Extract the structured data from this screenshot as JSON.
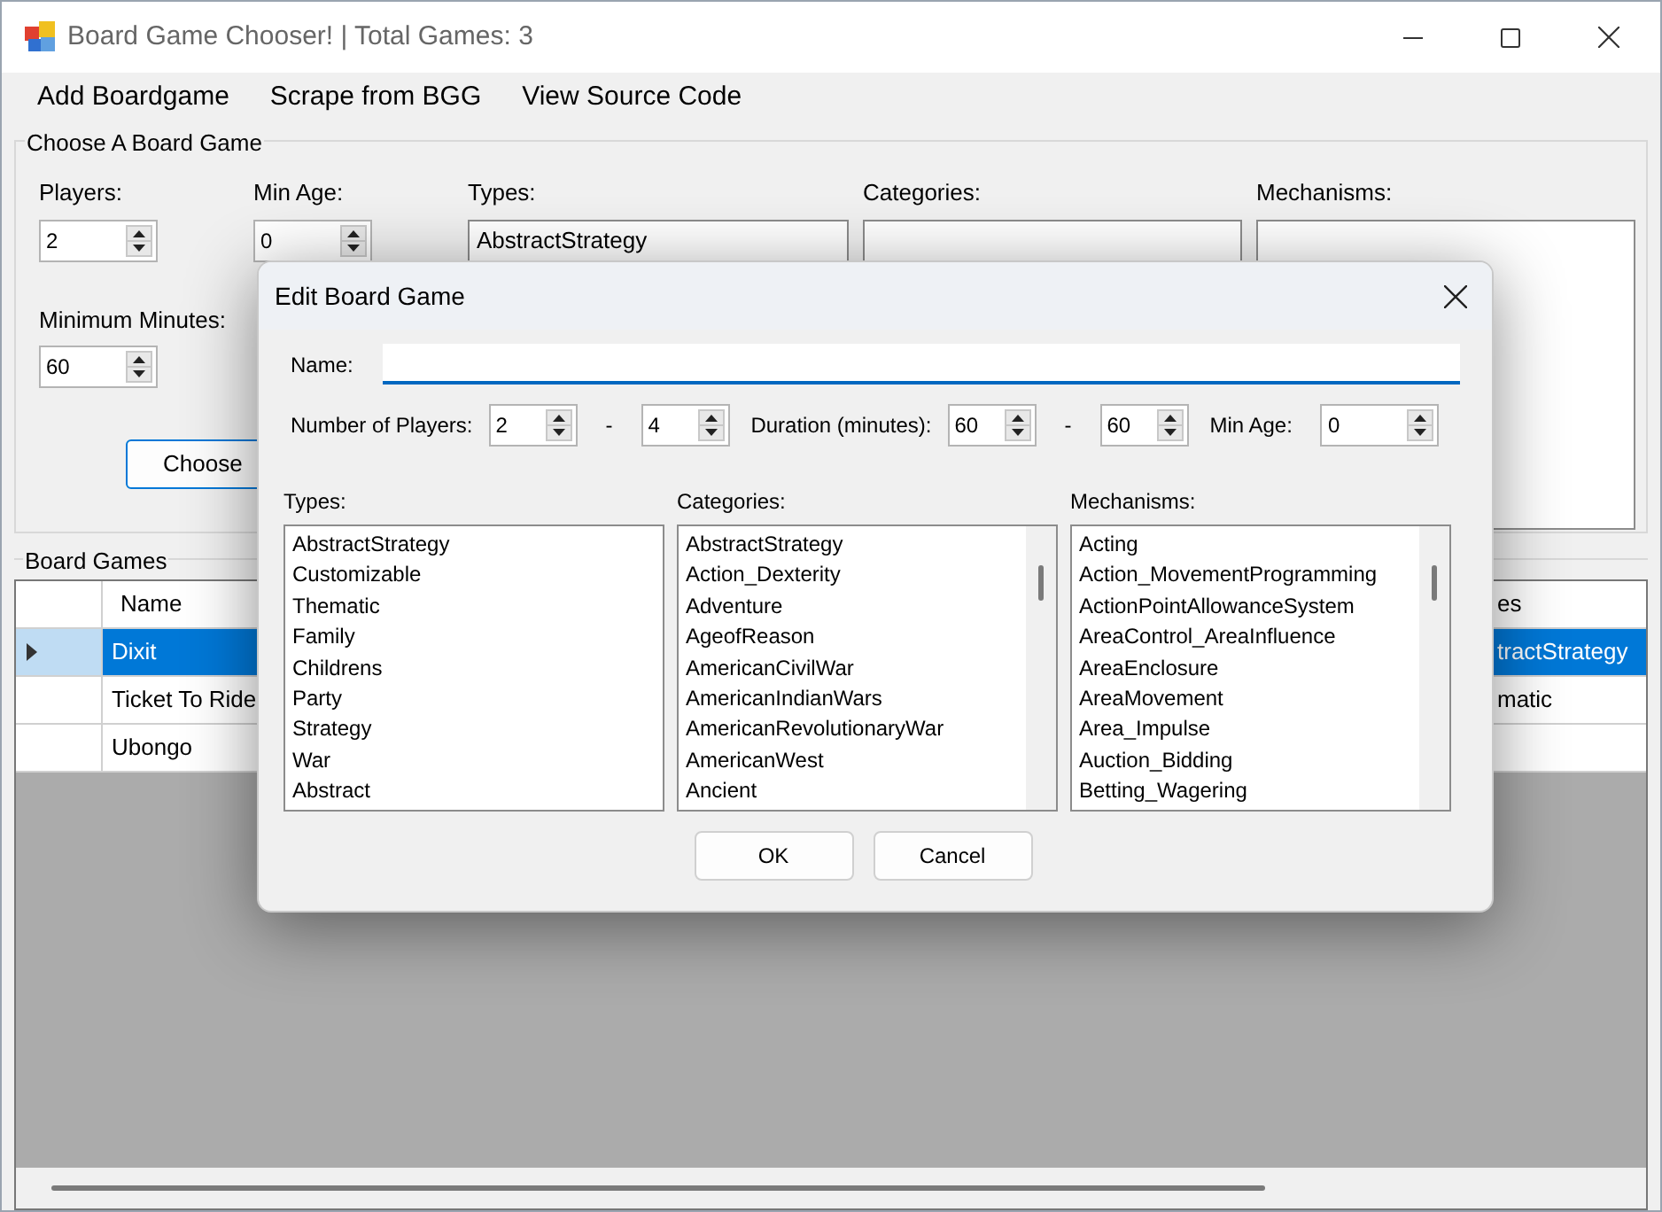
{
  "window": {
    "title": "Board Game Chooser! | Total Games: 3"
  },
  "menu": [
    "Add Boardgame",
    "Scrape from BGG",
    "View Source Code"
  ],
  "filter_group": {
    "title": "Choose A Board Game",
    "players": {
      "label": "Players:",
      "value": "2"
    },
    "min_age": {
      "label": "Min Age:",
      "value": "0"
    },
    "minimum_minutes": {
      "label": "Minimum Minutes:",
      "value": "60"
    },
    "types": {
      "label": "Types:",
      "items": [
        "AbstractStrategy"
      ]
    },
    "categories": {
      "label": "Categories:"
    },
    "mechanisms": {
      "label": "Mechanisms:"
    },
    "choose_button": "Choose"
  },
  "games_group": {
    "title": "Board Games",
    "columns": [
      "Name",
      "es"
    ],
    "rows": [
      {
        "cells": [
          "Dixit",
          "tractStrategy"
        ],
        "selected": true
      },
      {
        "cells": [
          "Ticket To Ride",
          "matic"
        ],
        "selected": false
      },
      {
        "cells": [
          "Ubongo",
          ""
        ],
        "selected": false
      }
    ]
  },
  "dialog": {
    "title": "Edit Board Game",
    "name_label": "Name:",
    "players_label": "Number of Players:",
    "players_min": "2",
    "players_max": "4",
    "duration_label": "Duration (minutes):",
    "duration_min": "60",
    "duration_max": "60",
    "min_age_label": "Min Age:",
    "min_age": "0",
    "range_separator": "-",
    "lists": [
      {
        "label": "Types:",
        "scrollbar": false,
        "items": [
          "AbstractStrategy",
          "Customizable",
          "Thematic",
          "Family",
          "Childrens",
          "Party",
          "Strategy",
          "War",
          "Abstract"
        ]
      },
      {
        "label": "Categories:",
        "scrollbar": true,
        "items": [
          "AbstractStrategy",
          "Action_Dexterity",
          "Adventure",
          "AgeofReason",
          "AmericanCivilWar",
          "AmericanIndianWars",
          "AmericanRevolutionaryWar",
          "AmericanWest",
          "Ancient"
        ]
      },
      {
        "label": "Mechanisms:",
        "scrollbar": true,
        "items": [
          "Acting",
          "Action_MovementProgramming",
          "ActionPointAllowanceSystem",
          "AreaControl_AreaInfluence",
          "AreaEnclosure",
          "AreaMovement",
          "Area_Impulse",
          "Auction_Bidding",
          "Betting_Wagering"
        ]
      }
    ],
    "buttons": [
      "OK",
      "Cancel"
    ]
  }
}
